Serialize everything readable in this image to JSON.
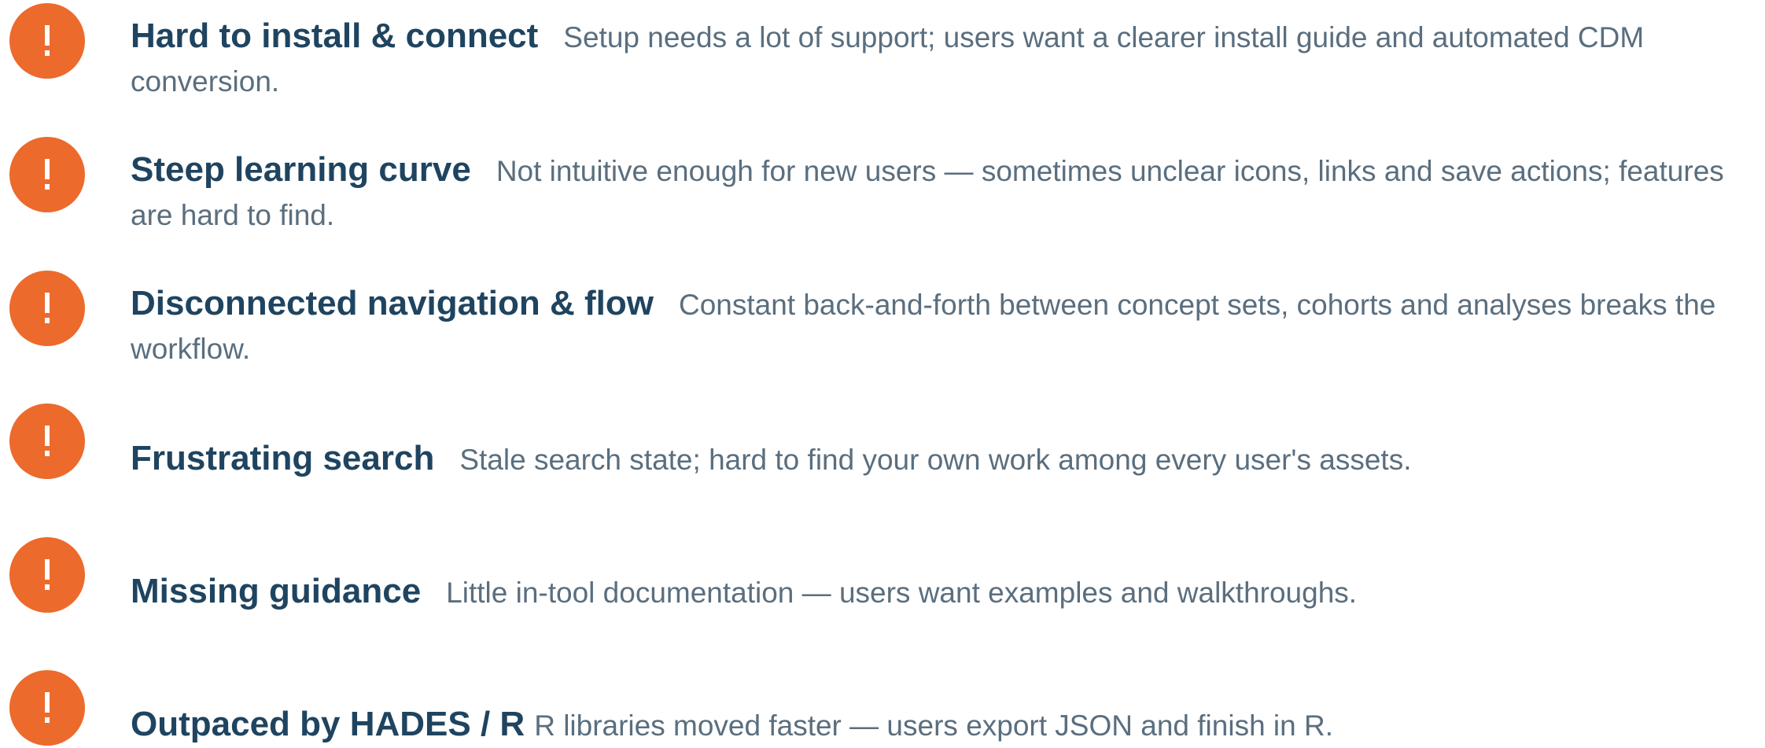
{
  "colors": {
    "badge": "#ec6a2c",
    "title": "#1f4460",
    "description": "#5a6e7e",
    "badge_glyph": "#ffffff"
  },
  "items": [
    {
      "icon": "exclamation-icon",
      "title": "Hard to install & connect",
      "description": "Setup needs a lot of support; users want a clearer install guide and automated CDM conversion."
    },
    {
      "icon": "exclamation-icon",
      "title": "Steep learning curve",
      "description": "Not intuitive enough for new users — sometimes unclear icons, links and save actions; features are hard to find."
    },
    {
      "icon": "exclamation-icon",
      "title": "Disconnected navigation & flow",
      "description": "Constant back-and-forth between concept sets, cohorts and analyses breaks the workflow."
    },
    {
      "icon": "exclamation-icon",
      "title": "Frustrating search",
      "description": "Stale search state; hard to find your own work among every user's assets."
    },
    {
      "icon": "exclamation-icon",
      "title": "Missing guidance",
      "description": "Little in-tool documentation — users want examples and walkthroughs."
    },
    {
      "icon": "exclamation-icon",
      "title": "Outpaced by HADES / R",
      "description": "R libraries moved faster — users export JSON and finish in R."
    }
  ]
}
